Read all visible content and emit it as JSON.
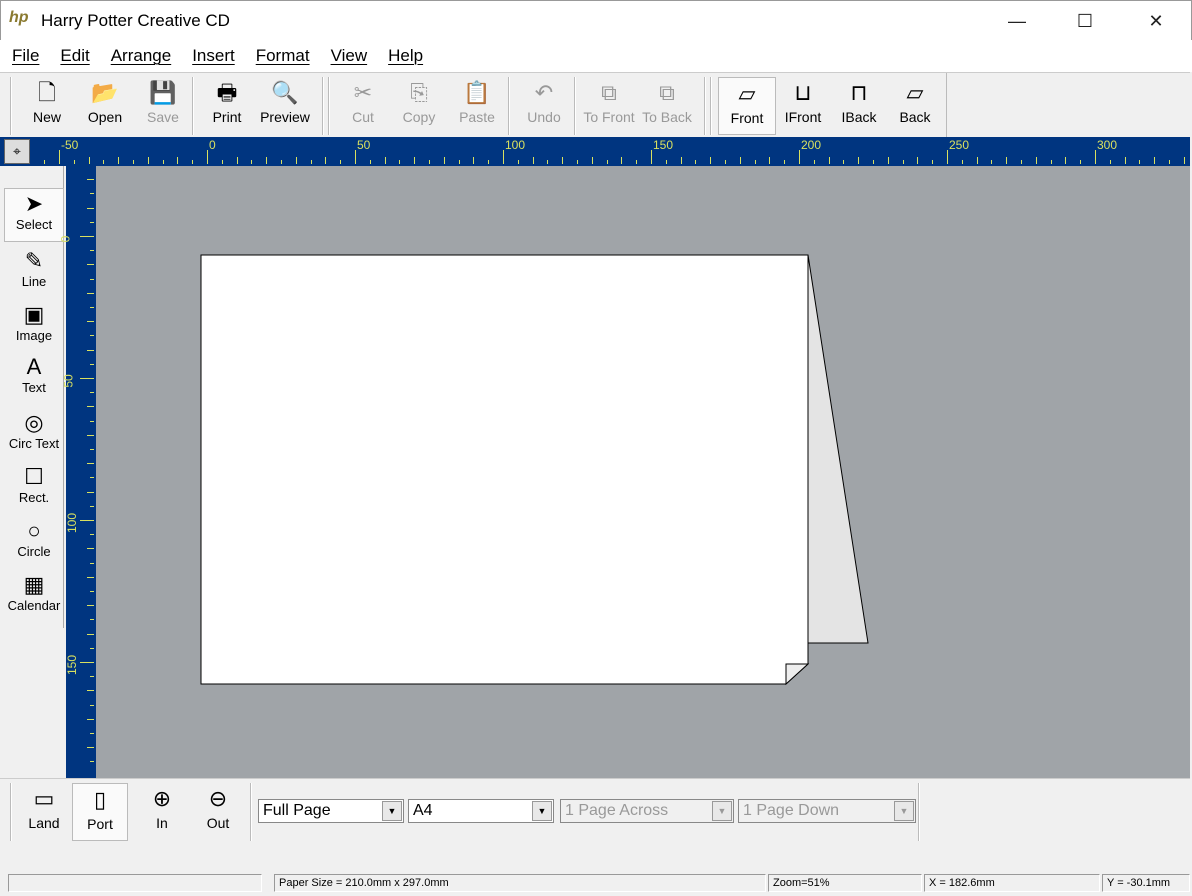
{
  "window": {
    "title": "Harry Potter Creative CD",
    "logo": "hp",
    "minimize": "—",
    "maximize": "☐",
    "close": "✕"
  },
  "menu": [
    "File",
    "Edit",
    "Arrange",
    "Insert",
    "Format",
    "View",
    "Help"
  ],
  "toolbar": [
    {
      "label": "New",
      "icon": "new-document-icon",
      "glyph": "🗋",
      "disabled": false
    },
    {
      "label": "Open",
      "icon": "open-folder-icon",
      "glyph": "📂",
      "disabled": false
    },
    {
      "label": "Save",
      "icon": "save-disk-icon",
      "glyph": "💾",
      "disabled": true
    },
    {
      "label": "Print",
      "icon": "printer-icon",
      "glyph": "🖶",
      "disabled": false
    },
    {
      "label": "Preview",
      "icon": "preview-icon",
      "glyph": "🔍",
      "disabled": false
    },
    {
      "label": "Cut",
      "icon": "scissors-icon",
      "glyph": "✂",
      "disabled": true
    },
    {
      "label": "Copy",
      "icon": "copy-icon",
      "glyph": "⎘",
      "disabled": true
    },
    {
      "label": "Paste",
      "icon": "paste-icon",
      "glyph": "📋",
      "disabled": true
    },
    {
      "label": "Undo",
      "icon": "undo-icon",
      "glyph": "↶",
      "disabled": true
    },
    {
      "label": "To Front",
      "icon": "to-front-icon",
      "glyph": "⧉",
      "disabled": true
    },
    {
      "label": "To Back",
      "icon": "to-back-icon",
      "glyph": "⧉",
      "disabled": true
    },
    {
      "label": "Front",
      "icon": "front-view-icon",
      "glyph": "▱",
      "disabled": false,
      "selected": true
    },
    {
      "label": "IFront",
      "icon": "inside-front-icon",
      "glyph": "⊔",
      "disabled": false
    },
    {
      "label": "IBack",
      "icon": "inside-back-icon",
      "glyph": "⊓",
      "disabled": false
    },
    {
      "label": "Back",
      "icon": "back-view-icon",
      "glyph": "▱",
      "disabled": false
    }
  ],
  "tools": [
    {
      "label": "Select",
      "icon": "arrow-pointer-icon",
      "glyph": "➤",
      "selected": true
    },
    {
      "label": "Line",
      "icon": "pen-icon",
      "glyph": "✎"
    },
    {
      "label": "Image",
      "icon": "image-icon",
      "glyph": "▣"
    },
    {
      "label": "Text",
      "icon": "text-a-icon",
      "glyph": "A"
    },
    {
      "label": "Circ Text",
      "icon": "circular-text-icon",
      "glyph": "◎"
    },
    {
      "label": "Rect.",
      "icon": "rectangle-icon",
      "glyph": "☐"
    },
    {
      "label": "Circle",
      "icon": "circle-icon",
      "glyph": "○"
    },
    {
      "label": "Calendar",
      "icon": "calendar-icon",
      "glyph": "▦"
    }
  ],
  "ruler": {
    "h_labels": [
      "-50",
      "0",
      "50",
      "100",
      "150",
      "200",
      "250",
      "300"
    ],
    "v_labels": [
      "0",
      "50",
      "100",
      "150"
    ]
  },
  "bottom": {
    "buttons": [
      {
        "label": "Land",
        "glyph": "▭"
      },
      {
        "label": "Port",
        "glyph": "▯",
        "selected": true
      },
      {
        "label": "In",
        "glyph": "⊕"
      },
      {
        "label": "Out",
        "glyph": "⊖"
      }
    ],
    "view_select": "Full Page",
    "paper_select": "A4",
    "across_select": "1 Page Across",
    "down_select": "1 Page Down",
    "dropdown_glyph": "▼"
  },
  "status": {
    "paper_size": "Paper Size = 210.0mm x 297.0mm",
    "zoom": "Zoom=51%",
    "x": "X = 182.6mm",
    "y": "Y = -30.1mm"
  }
}
